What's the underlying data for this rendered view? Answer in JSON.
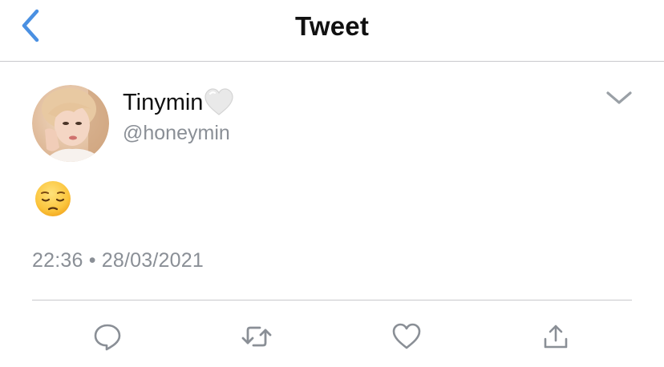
{
  "header": {
    "title": "Tweet",
    "back_icon": "chevron-left-icon",
    "accent_color": "#4a90e2"
  },
  "tweet": {
    "author": {
      "display_name": "Tinymin",
      "name_emoji": "white-heart-icon",
      "handle": "@honeymin",
      "avatar": "profile-photo"
    },
    "text_emoji": "pensive-face-emoji",
    "timestamp": "22:36 • 28/03/2021",
    "menu_icon": "chevron-down-icon"
  },
  "actions": [
    {
      "name": "reply",
      "icon": "reply-icon"
    },
    {
      "name": "retweet",
      "icon": "retweet-icon"
    },
    {
      "name": "like",
      "icon": "heart-outline-icon"
    },
    {
      "name": "share",
      "icon": "share-icon"
    }
  ],
  "colors": {
    "text_primary": "#111111",
    "text_secondary": "#8a8f96",
    "icon_gray": "#8a8f96",
    "divider": "#c8c8cc"
  }
}
